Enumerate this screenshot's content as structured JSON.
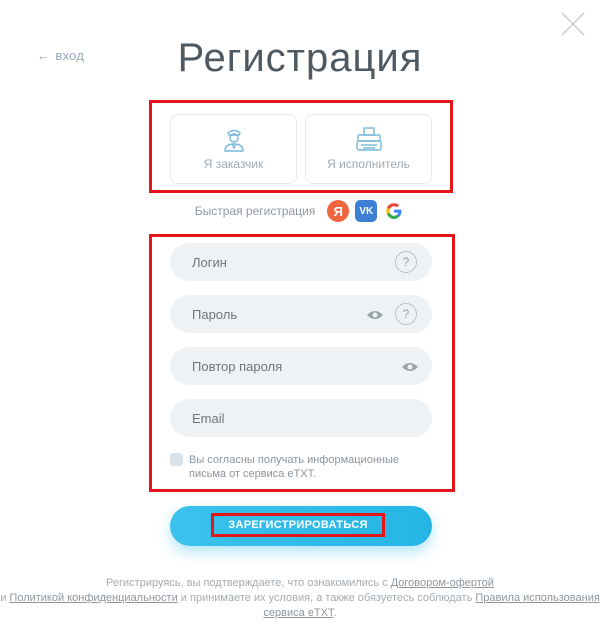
{
  "header": {
    "back_label": "вход",
    "title": "Регистрация"
  },
  "roles": [
    {
      "label": "Я заказчик",
      "icon": "customer-icon"
    },
    {
      "label": "Я исполнитель",
      "icon": "typewriter-icon"
    }
  ],
  "quick_registration": {
    "label": "Быстрая регистрация",
    "yandex_letter": "Я",
    "vk_letters": "VK",
    "google_letter": "G"
  },
  "form": {
    "login_placeholder": "Логин",
    "password_placeholder": "Пароль",
    "repeat_password_placeholder": "Повтор пароля",
    "email_placeholder": "Email",
    "help_symbol": "?",
    "newsletter_label": "Вы согласны получать информационные письма от сервиса eTXT.",
    "submit_label": "ЗАРЕГИСТРИРОВАТЬСЯ"
  },
  "footer": {
    "text1": "Регистрируясь, вы подтверждаете, что ознакомились с",
    "link_offer": "Договором-офертой",
    "text2": "и",
    "link_privacy": "Политикой конфиденциальности",
    "text3": "и принимаете их условия, а также обязуетесь соблюдать",
    "link_rules": "Правила использования сервиса eTXT"
  },
  "colors": {
    "accent": "#25b5e5",
    "highlight_border": "#e4161a",
    "field_bg": "#eef2f5",
    "yandex": "#f0653e",
    "vk": "#3f7fd3"
  }
}
